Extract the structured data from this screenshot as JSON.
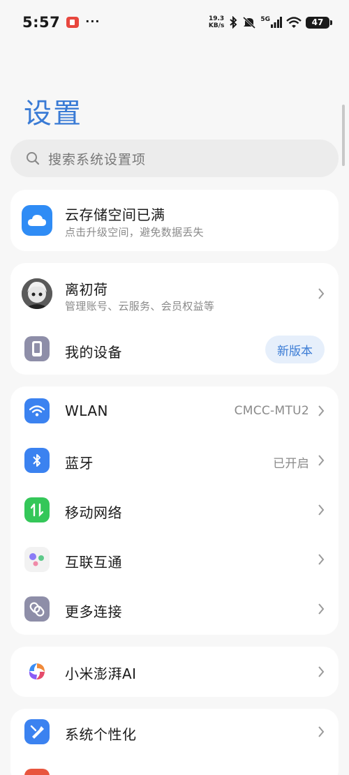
{
  "status_bar": {
    "time": "5:57",
    "dots": "···",
    "net_speed_value": "19.3",
    "net_speed_unit": "KB/s",
    "signal_label": "5G",
    "battery": "47"
  },
  "header": {
    "title": "设置"
  },
  "search": {
    "placeholder": "搜索系统设置项"
  },
  "cloud_card": {
    "title": "云存储空间已满",
    "subtitle": "点击升级空间，避免数据丢失",
    "icon": "cloud-icon",
    "icon_color": "#2f8cf5"
  },
  "account_card": {
    "name": "离初荷",
    "subtitle": "管理账号、云服务、会员权益等",
    "device_label": "我的设备",
    "device_badge": "新版本"
  },
  "connectivity": [
    {
      "label": "WLAN",
      "value": "CMCC-MTU2",
      "icon": "wifi-icon",
      "color": "#3b82f0"
    },
    {
      "label": "蓝牙",
      "value": "已开启",
      "icon": "bluetooth-icon",
      "color": "#3b82f0"
    },
    {
      "label": "移动网络",
      "value": "",
      "icon": "mobile-data-icon",
      "color": "#34c759"
    },
    {
      "label": "互联互通",
      "value": "",
      "icon": "interconnect-icon",
      "color": "#f2f2f2"
    },
    {
      "label": "更多连接",
      "value": "",
      "icon": "link-icon",
      "color": "#8e8ea8"
    }
  ],
  "ai_card": {
    "label": "小米澎湃AI",
    "icon": "hyper-ai-icon"
  },
  "personal_card": {
    "label": "系统个性化",
    "icon": "personalize-icon",
    "color": "#3b82f0"
  },
  "colors": {
    "accent": "#3a7bd5",
    "background": "#f7f7f7",
    "card": "#ffffff"
  }
}
